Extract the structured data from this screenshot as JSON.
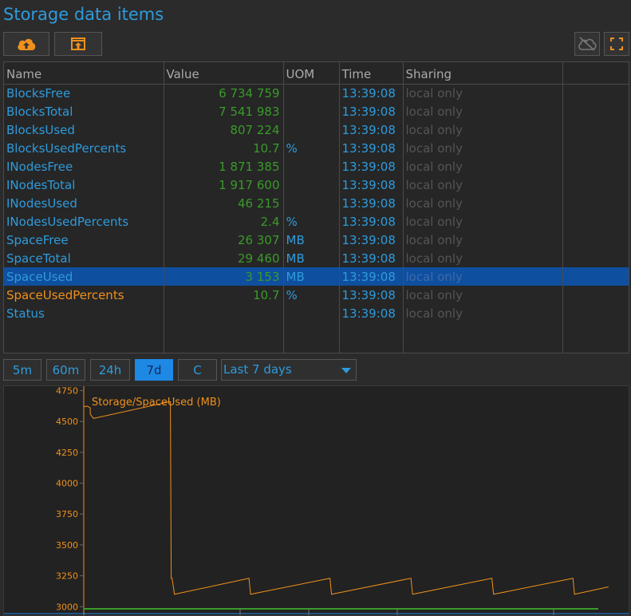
{
  "header": {
    "title": "Storage data items"
  },
  "toolbar": {
    "upload_icon": "cloud-upload-icon",
    "export_icon": "export-icon",
    "cloud_off_icon": "cloud-off-icon",
    "fullscreen_icon": "fullscreen-icon"
  },
  "table": {
    "columns": [
      "Name",
      "Value",
      "UOM",
      "Time",
      "Sharing"
    ],
    "rows": [
      {
        "name": "BlocksFree",
        "value": "6 734 759",
        "uom": "",
        "time": "13:39:08",
        "sharing": "local only"
      },
      {
        "name": "BlocksTotal",
        "value": "7 541 983",
        "uom": "",
        "time": "13:39:08",
        "sharing": "local only"
      },
      {
        "name": "BlocksUsed",
        "value": "807 224",
        "uom": "",
        "time": "13:39:08",
        "sharing": "local only"
      },
      {
        "name": "BlocksUsedPercents",
        "value": "10.7",
        "uom": "%",
        "time": "13:39:08",
        "sharing": "local only"
      },
      {
        "name": "INodesFree",
        "value": "1 871 385",
        "uom": "",
        "time": "13:39:08",
        "sharing": "local only"
      },
      {
        "name": "INodesTotal",
        "value": "1 917 600",
        "uom": "",
        "time": "13:39:08",
        "sharing": "local only"
      },
      {
        "name": "INodesUsed",
        "value": "46 215",
        "uom": "",
        "time": "13:39:08",
        "sharing": "local only"
      },
      {
        "name": "INodesUsedPercents",
        "value": "2.4",
        "uom": "%",
        "time": "13:39:08",
        "sharing": "local only"
      },
      {
        "name": "SpaceFree",
        "value": "26 307",
        "uom": "MB",
        "time": "13:39:08",
        "sharing": "local only"
      },
      {
        "name": "SpaceTotal",
        "value": "29 460",
        "uom": "MB",
        "time": "13:39:08",
        "sharing": "local only"
      },
      {
        "name": "SpaceUsed",
        "value": "3 153",
        "uom": "MB",
        "time": "13:39:08",
        "sharing": "local only"
      },
      {
        "name": "SpaceUsedPercents",
        "value": "10.7",
        "uom": "%",
        "time": "13:39:08",
        "sharing": "local only"
      },
      {
        "name": "Status",
        "value": "",
        "uom": "",
        "time": "13:39:08",
        "sharing": "local only"
      }
    ]
  },
  "range": {
    "buttons": [
      "5m",
      "60m",
      "24h",
      "7d",
      "C"
    ],
    "active": "7d",
    "selected": "Last 7 days"
  },
  "colors": {
    "accent": "#2e9bdc",
    "value_green": "#3a9a2a",
    "highlight_orange": "#f0901c",
    "selection": "#0f4fa0",
    "series": "#f0901c"
  },
  "chart_data": {
    "type": "line",
    "title": "",
    "series": [
      {
        "name": "Storage/SpaceUsed (MB)",
        "values": [
          4620,
          4625,
          4610,
          4560,
          4525,
          4660,
          4660,
          3230,
          3230,
          3100,
          3230,
          3100,
          3230,
          3100,
          3230,
          3100,
          3230,
          3100,
          3230,
          3100,
          3160
        ]
      }
    ],
    "x": [
      0.0,
      0.02,
      0.04,
      0.04,
      0.06,
      0.53,
      0.535,
      0.54,
      0.545,
      0.56,
      1.02,
      1.03,
      1.52,
      1.53,
      2.02,
      2.03,
      2.52,
      2.53,
      3.02,
      3.03,
      3.24
    ],
    "y_ticks": [
      3000,
      3250,
      3500,
      3750,
      4000,
      4250,
      4500,
      4750
    ],
    "ylim": [
      2950,
      4760
    ],
    "xlim": [
      0,
      3.3
    ],
    "grid": false
  }
}
